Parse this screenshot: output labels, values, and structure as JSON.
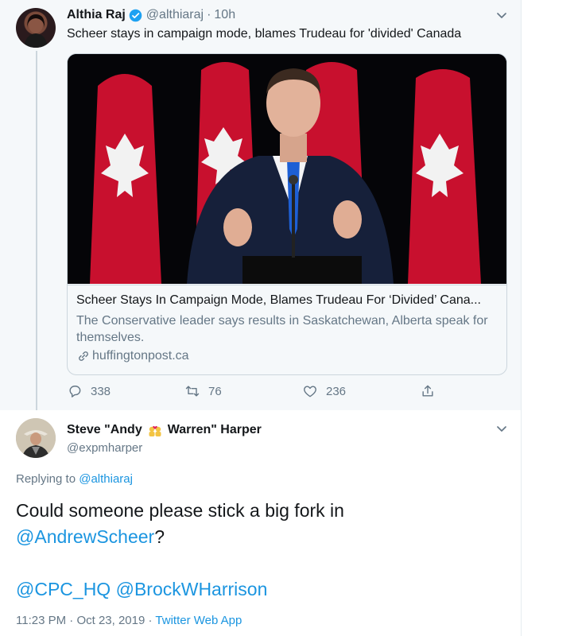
{
  "tweet1": {
    "name": "Althia Raj",
    "handle": "@althiaraj",
    "time": "10h",
    "text": "Scheer stays in campaign mode, blames Trudeau for 'divided' Canada",
    "card": {
      "title": "Scheer Stays In Campaign Mode, Blames Trudeau For ‘Divided’ Cana...",
      "description": "The Conservative leader says results in Saskatchewan, Alberta speak for themselves.",
      "domain": "huffingtonpost.ca"
    },
    "actions": {
      "replies": "338",
      "retweets": "76",
      "likes": "236"
    }
  },
  "tweet2": {
    "name_part1": "Steve \"Andy",
    "name_part2": "Warren\" Harper",
    "handle": "@expmharper",
    "replying_prefix": "Replying to",
    "replying_to": "@althiaraj",
    "text_line1": "Could someone please stick a big fork in",
    "mention1": "@AndrewScheer",
    "text_after_mention": "?",
    "mention2": "@CPC_HQ",
    "mention3": "@BrockWHarrison",
    "time": "11:23 PM",
    "date": "Oct 23, 2019",
    "source": "Twitter Web App"
  },
  "icons": {
    "verified": "verified-badge-icon",
    "reply": "reply-icon",
    "retweet": "retweet-icon",
    "like": "heart-icon",
    "share": "share-icon",
    "link": "link-icon",
    "caret": "chevron-down-icon",
    "emoji": "couple-with-heart-emoji-icon"
  },
  "colors": {
    "accent": "#1b95e0",
    "verified": "#1da1f2",
    "muted": "#657786",
    "thread_bg": "#f5f8fa"
  }
}
